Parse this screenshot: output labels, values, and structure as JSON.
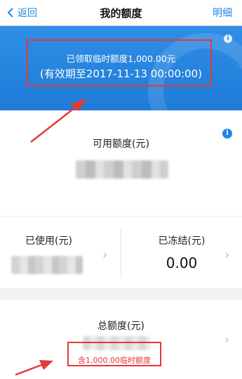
{
  "header": {
    "back_label": "返回",
    "title": "我的额度",
    "detail_label": "明细"
  },
  "banner": {
    "line1": "已领取临时额度1,000.00元",
    "line2": "(有效期至2017-11-13 00:00:00)"
  },
  "available": {
    "label": "可用额度(元)"
  },
  "used": {
    "label": "已使用(元)"
  },
  "frozen": {
    "label": "已冻结(元)",
    "value": "0.00"
  },
  "total": {
    "label": "总额度(元)",
    "sub": "含1,000.00临时额度"
  },
  "colors": {
    "accent": "#1e88e5",
    "banner": "#2f8ee6",
    "highlight": "#e53935"
  },
  "icons": {
    "back": "chevron-left-icon",
    "info": "info-icon",
    "row_chevron": "chevron-right-icon"
  }
}
